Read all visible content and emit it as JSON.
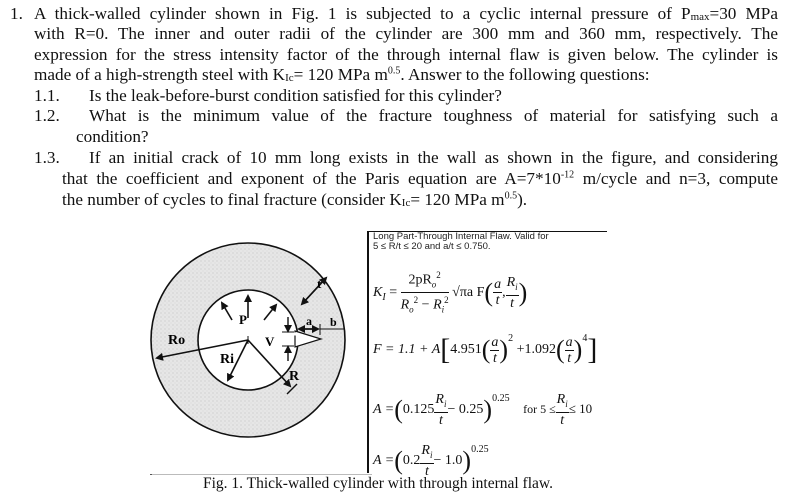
{
  "problem": {
    "number": "1.",
    "intro_lines": [
      "A thick-walled cylinder shown in Fig. 1 is subjected to a cyclic internal pressure of P",
      "with R=0. The inner and outer radii of the cylinder are 300 mm and 360 mm, respectively. The",
      "expression for the stress intensity factor of the through internal flaw is given below. The cylinder is",
      "made of a high-strength steel with K"
    ],
    "pmax_sub": "max",
    "pmax_value": "=30 MPa",
    "kic_sub": "Ic",
    "kic_value": "= 120 MPa m",
    "kic_exp": "0.5",
    "line4_tail": ". Answer to the following questions:",
    "questions": [
      {
        "num": "1.1.",
        "text": "Is the leak-before-burst condition satisfied for this cylinder?"
      },
      {
        "num": "1.2.",
        "text_lines": [
          "What is the minimum value of the fracture toughness of material for satisfying such a",
          "condition?"
        ]
      },
      {
        "num": "1.3.",
        "text_lines": [
          "If an initial crack of 10 mm long exists in the wall as shown in the figure, and considering",
          "that the coefficient and exponent of the Paris equation are A=7*10",
          "the number of cycles to final fracture (consider K"
        ],
        "paris_exp": "-12",
        "paris_tail": " m/cycle and n=3, compute",
        "kic_sub": "Ic",
        "kic_value": "= 120 MPa m",
        "kic_exp": "0.5",
        "tail": ")."
      }
    ]
  },
  "figure": {
    "labels": {
      "Ro": "Ro",
      "Ri": "Ri",
      "P": "P",
      "V": "V",
      "R": "R",
      "t": "t",
      "a": "a",
      "b": "b"
    },
    "panel_header_line1": "Long Part-Through Internal Flaw.  Valid for",
    "panel_header_line2": "5 ≤ R/t ≤ 20 and a/t ≤ 0.750.",
    "equations": {
      "KI_lhs": "K",
      "KI_sub": "I",
      "KI_num": "2pR",
      "KI_den": "R",
      "KI_mid": "√πa F",
      "F_lhs": "F = 1.1 + A",
      "F_c1": "4.951",
      "F_c2": "+1.092",
      "F_e1": "2",
      "F_e2": "4",
      "A1_lhs": "A =",
      "A1_c": "0.125",
      "A1_tail": "− 0.25",
      "A1_exp": "0.25",
      "A1_cond": "for 5 ≤",
      "A1_cond_tail": "≤ 10",
      "A2_lhs": "A =",
      "A2_c": "0.2",
      "A2_tail": "− 1.0",
      "A2_exp": "0.25"
    },
    "caption": "Fig. 1. Thick-walled cylinder with through internal flaw."
  }
}
